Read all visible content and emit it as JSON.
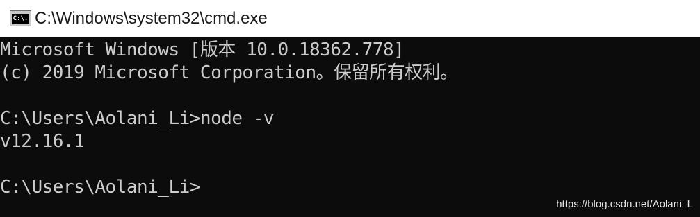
{
  "window": {
    "title": "C:\\Windows\\system32\\cmd.exe",
    "icon": "console-icon",
    "icon_label": "C:\\."
  },
  "console": {
    "background": "#0c0c0c",
    "foreground": "#cccccc",
    "lines": [
      "Microsoft Windows [版本 10.0.18362.778]",
      "(c) 2019 Microsoft Corporation。保留所有权利。",
      "",
      "C:\\Users\\Aolani_Li>node -v",
      "v12.16.1",
      "",
      "C:\\Users\\Aolani_Li>"
    ]
  },
  "watermark": "https://blog.csdn.net/Aolani_L"
}
